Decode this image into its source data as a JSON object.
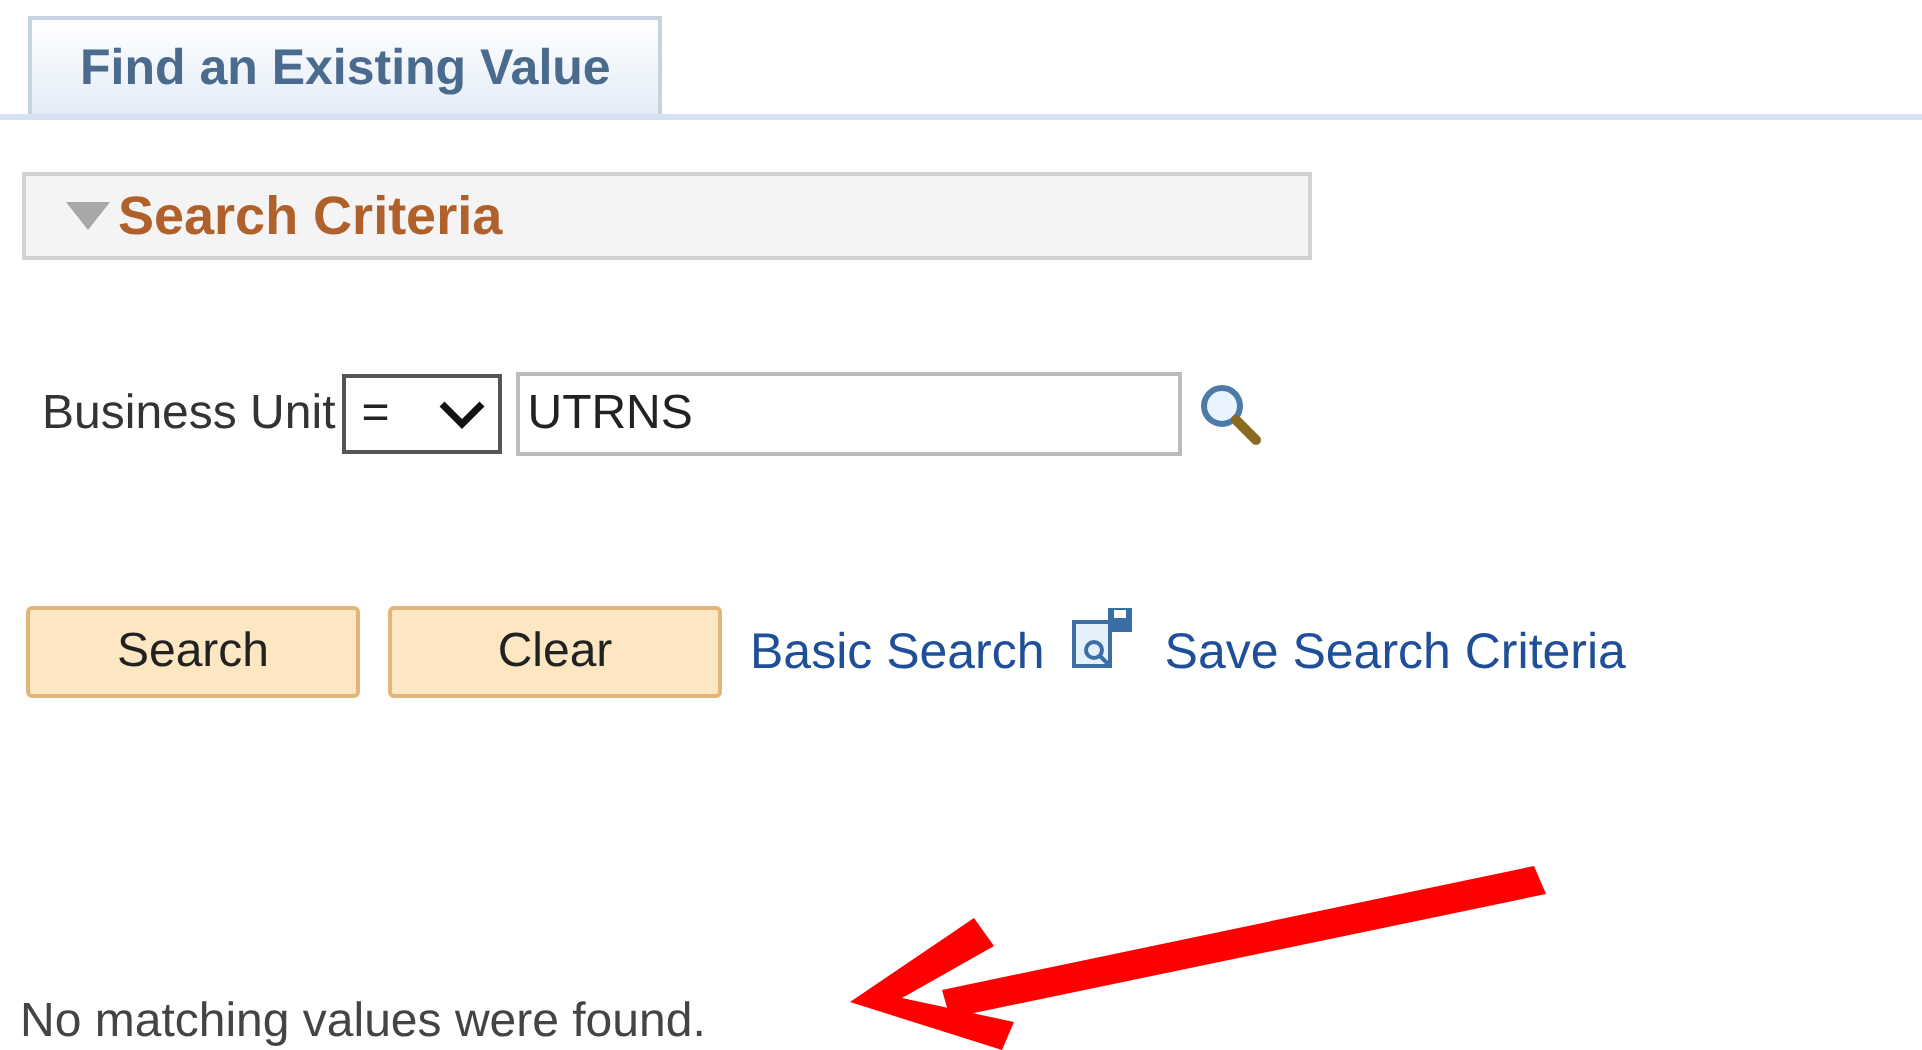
{
  "tabs": [
    {
      "label": "Find an Existing Value",
      "selected": true
    }
  ],
  "section": {
    "title": "Search Criteria",
    "expanded": true
  },
  "fields": [
    {
      "label": "Business Unit",
      "operator": "=",
      "value": "UTRNS"
    }
  ],
  "buttons": [
    "Search",
    "Clear"
  ],
  "links": [
    {
      "label": "Basic Search",
      "kind": "plain"
    },
    {
      "label": "Save Search Criteria",
      "kind": "save"
    }
  ],
  "message": "No matching values were found."
}
